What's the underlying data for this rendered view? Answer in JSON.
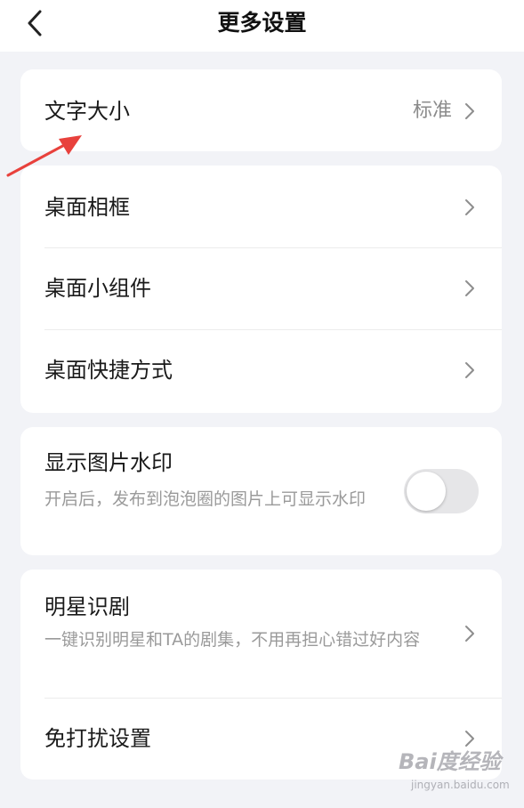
{
  "header": {
    "title": "更多设置",
    "back_icon": "chevron-left-icon"
  },
  "font_size_card": {
    "label": "文字大小",
    "value": "标准"
  },
  "desktop_card": {
    "items": [
      {
        "label": "桌面相框"
      },
      {
        "label": "桌面小组件"
      },
      {
        "label": "桌面快捷方式"
      }
    ]
  },
  "watermark_card": {
    "label": "显示图片水印",
    "description": "开启后，发布到泡泡圈的图片上可显示水印",
    "enabled": false
  },
  "misc_card": {
    "star_label": "明星识剧",
    "star_description": "一键识别明星和TA的剧集，不用再担心错过好内容",
    "dnd_label": "免打扰设置"
  },
  "overlay": {
    "watermark_logo": "Bai度经验",
    "watermark_sub": "jingyan.baidu.com"
  },
  "colors": {
    "background": "#f2f3f7",
    "card": "#ffffff",
    "annotation_arrow": "#e8413c",
    "toggle_off": "#e6e6e8"
  }
}
